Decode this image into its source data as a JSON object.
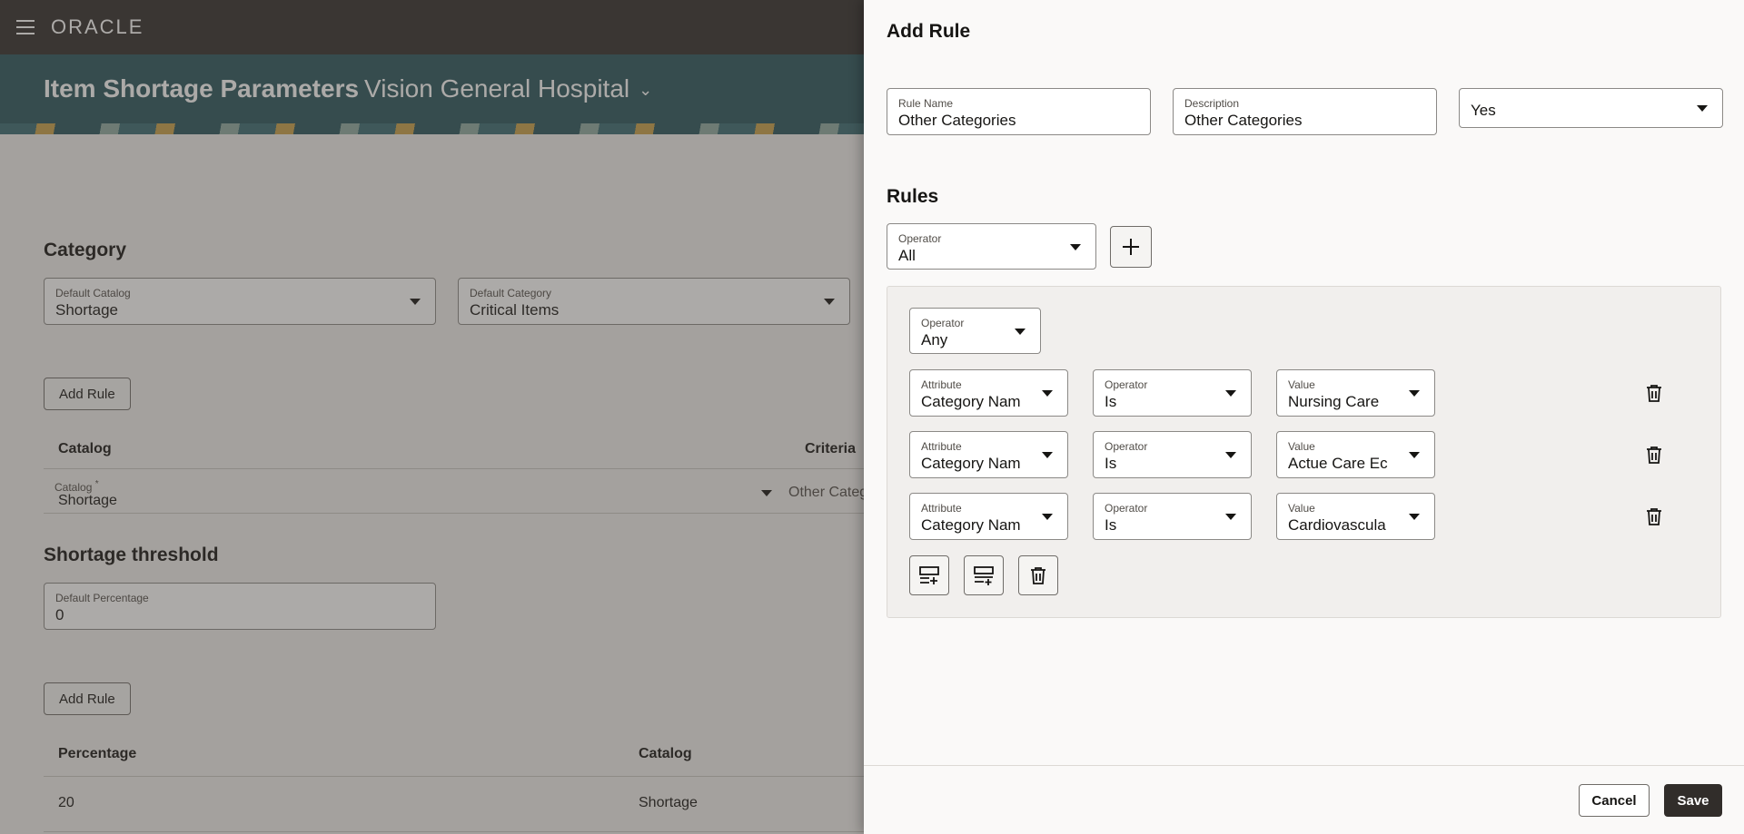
{
  "app": {
    "logo": "ORACLE",
    "page_title": "Item Shortage Parameters",
    "page_subtitle": "Vision General Hospital"
  },
  "background": {
    "category_heading": "Category",
    "default_catalog": {
      "label": "Default Catalog",
      "value": "Shortage"
    },
    "default_category": {
      "label": "Default Category",
      "value": "Critical Items"
    },
    "add_rule_label": "Add Rule",
    "catalog_table": {
      "headers": [
        "Catalog",
        "Criteria"
      ],
      "row": {
        "field_label": "Catalog",
        "required_mark": "*",
        "value": "Shortage",
        "criteria": "Other Categ"
      }
    },
    "threshold_heading": "Shortage threshold",
    "default_percentage": {
      "label": "Default Percentage",
      "value": "0"
    },
    "add_rule_label_2": "Add Rule",
    "threshold_table": {
      "headers": [
        "Percentage",
        "Catalog"
      ],
      "rows": [
        {
          "percentage": "20",
          "catalog": "Shortage"
        }
      ]
    }
  },
  "drawer": {
    "title": "Add Rule",
    "rule_name": {
      "label": "Rule Name",
      "value": "Other Categories"
    },
    "description": {
      "label": "Description",
      "value": "Other Categories"
    },
    "enabled_select": {
      "value": "Yes"
    },
    "rules_heading": "Rules",
    "top_operator": {
      "label": "Operator",
      "value": "All"
    },
    "group_operator": {
      "label": "Operator",
      "value": "Any"
    },
    "conditions": [
      {
        "attr_label": "Attribute",
        "attr_value": "Category Nam",
        "op_label": "Operator",
        "op_value": "Is",
        "val_label": "Value",
        "val_value": "Nursing Care"
      },
      {
        "attr_label": "Attribute",
        "attr_value": "Category Nam",
        "op_label": "Operator",
        "op_value": "Is",
        "val_label": "Value",
        "val_value": "Actue Care Ec"
      },
      {
        "attr_label": "Attribute",
        "attr_value": "Category Nam",
        "op_label": "Operator",
        "op_value": "Is",
        "val_label": "Value",
        "val_value": "Cardiovascula"
      }
    ],
    "cancel_label": "Cancel",
    "save_label": "Save"
  },
  "icons": {
    "menu": "hamburger-menu-icon",
    "chevron": "chevron-down-icon",
    "add": "plus-icon",
    "delete": "trash-icon",
    "add_condition": "add-row-icon",
    "add_group": "add-group-icon"
  },
  "colors": {
    "header_bg": "#312d2a",
    "banner_bg": "#29545c",
    "primary_button": "#312d2a"
  }
}
